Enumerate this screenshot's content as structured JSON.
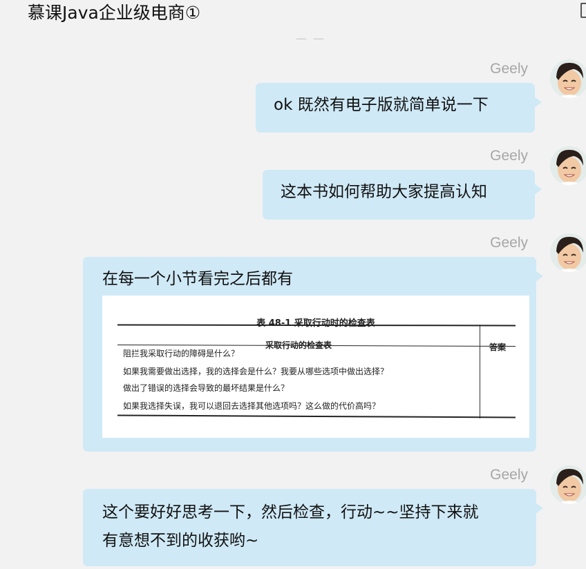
{
  "header": {
    "title": "慕课Java企业级电商①"
  },
  "messages": [
    {
      "sender": "Geely",
      "text": "ok 既然有电子版就简单说一下"
    },
    {
      "sender": "Geely",
      "text": "这本书如何帮助大家提高认知"
    },
    {
      "sender": "Geely",
      "text": "在每一个小节看完之后都有",
      "image": {
        "caption": "表 48-1   采取行动时的检查表",
        "header_main": "采取行动的检查表",
        "header_answer": "答案",
        "rows": [
          "阻拦我采取行动的障碍是什么？",
          "如果我需要做出选择，我的选择会是什么？我要从哪些选项中做出选择？",
          "做出了错误的选择会导致的最坏结果是什么？",
          "如果我选择失误，我可以退回去选择其他选项吗？这么做的代价高吗？"
        ]
      }
    },
    {
      "sender": "Geely",
      "text": "这个要好好思考一下，然后检查，行动~~坚持下来就\n有意想不到的收获哟~"
    }
  ],
  "colors": {
    "bubble": "#cfe9f6",
    "background": "#f2f2f2",
    "sender": "#a6a6a6"
  },
  "icons": [
    "avatar"
  ]
}
